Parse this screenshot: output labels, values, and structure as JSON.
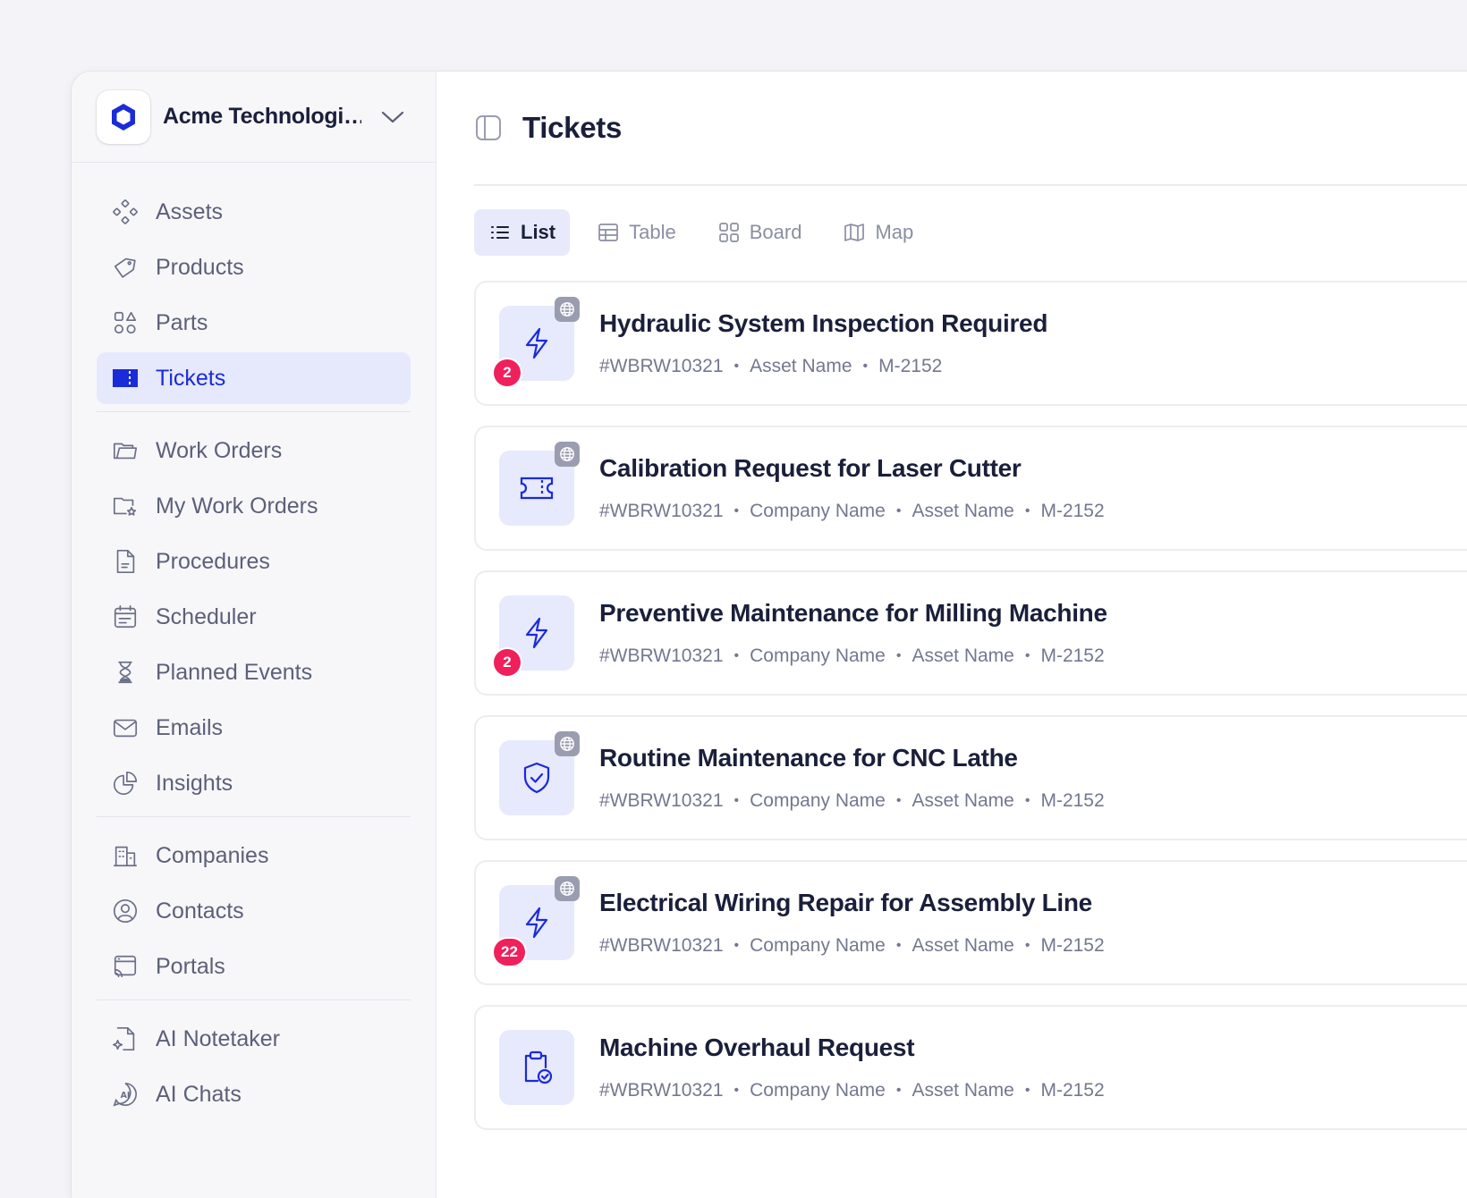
{
  "org": {
    "name": "Acme Technologi…"
  },
  "sidebar": {
    "items": [
      {
        "id": "assets",
        "label": "Assets",
        "icon": "assets-icon"
      },
      {
        "id": "products",
        "label": "Products",
        "icon": "tag-icon"
      },
      {
        "id": "parts",
        "label": "Parts",
        "icon": "shapes-icon"
      },
      {
        "id": "tickets",
        "label": "Tickets",
        "icon": "ticket-icon",
        "active": true
      },
      {
        "id": "work-orders",
        "label": "Work Orders",
        "icon": "folder-icon"
      },
      {
        "id": "my-work-orders",
        "label": "My Work Orders",
        "icon": "folder-star-icon"
      },
      {
        "id": "procedures",
        "label": "Procedures",
        "icon": "document-icon"
      },
      {
        "id": "scheduler",
        "label": "Scheduler",
        "icon": "calendar-icon"
      },
      {
        "id": "planned-events",
        "label": "Planned Events",
        "icon": "hourglass-icon"
      },
      {
        "id": "emails",
        "label": "Emails",
        "icon": "mail-icon"
      },
      {
        "id": "insights",
        "label": "Insights",
        "icon": "pie-chart-icon"
      },
      {
        "id": "companies",
        "label": "Companies",
        "icon": "building-icon"
      },
      {
        "id": "contacts",
        "label": "Contacts",
        "icon": "user-circle-icon"
      },
      {
        "id": "portals",
        "label": "Portals",
        "icon": "portal-icon"
      },
      {
        "id": "ai-notetaker",
        "label": "AI Notetaker",
        "icon": "ai-note-icon"
      },
      {
        "id": "ai-chats",
        "label": "AI Chats",
        "icon": "ai-chat-icon"
      }
    ]
  },
  "header": {
    "title": "Tickets"
  },
  "view_tabs": [
    {
      "id": "list",
      "label": "List",
      "icon": "list-icon",
      "active": true
    },
    {
      "id": "table",
      "label": "Table",
      "icon": "table-icon"
    },
    {
      "id": "board",
      "label": "Board",
      "icon": "board-icon"
    },
    {
      "id": "map",
      "label": "Map",
      "icon": "map-icon"
    }
  ],
  "tickets": [
    {
      "title": "Hydraulic System Inspection Required",
      "icon": "lightning-icon",
      "globe": true,
      "badge": "2",
      "meta": [
        "#WBRW10321",
        "Asset Name",
        "M-2152"
      ]
    },
    {
      "title": "Calibration Request for Laser Cutter",
      "icon": "ticket-icon",
      "globe": true,
      "badge": "",
      "meta": [
        "#WBRW10321",
        "Company Name",
        "Asset Name",
        "M-2152"
      ]
    },
    {
      "title": "Preventive Maintenance for Milling Machine",
      "icon": "lightning-icon",
      "globe": false,
      "badge": "2",
      "meta": [
        "#WBRW10321",
        "Company Name",
        "Asset Name",
        "M-2152"
      ]
    },
    {
      "title": "Routine Maintenance for CNC Lathe",
      "icon": "shield-check-icon",
      "globe": true,
      "badge": "",
      "meta": [
        "#WBRW10321",
        "Company Name",
        "Asset Name",
        "M-2152"
      ]
    },
    {
      "title": "Electrical Wiring Repair for Assembly Line",
      "icon": "lightning-icon",
      "globe": true,
      "badge": "22",
      "meta": [
        "#WBRW10321",
        "Company Name",
        "Asset Name",
        "M-2152"
      ]
    },
    {
      "title": "Machine Overhaul Request",
      "icon": "clipboard-check-icon",
      "globe": false,
      "badge": "",
      "meta": [
        "#WBRW10321",
        "Company Name",
        "Asset Name",
        "M-2152"
      ]
    }
  ],
  "colors": {
    "accent": "#1a2bd8",
    "badge": "#f0205c",
    "active_bg": "#e6e8fc"
  }
}
